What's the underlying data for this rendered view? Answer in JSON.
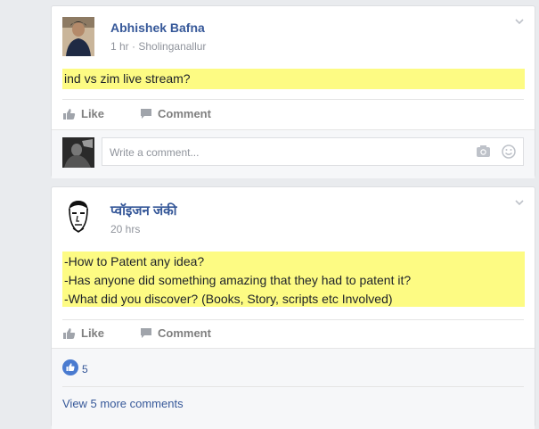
{
  "posts": [
    {
      "author": "Abhishek Bafna",
      "time": "1 hr",
      "separator": " · ",
      "location": "Sholinganallur",
      "lines": [
        "ind vs zim live stream?"
      ],
      "like_label": "Like",
      "comment_label": "Comment",
      "comment_placeholder": "Write a comment..."
    },
    {
      "author": "प्वॉइजन जंकी",
      "time": "20 hrs",
      "lines": [
        "-How to Patent any idea?",
        "-Has anyone did something amazing that they had to patent it?",
        "-What did you discover? (Books, Story, scripts etc Involved)"
      ],
      "like_label": "Like",
      "comment_label": "Comment",
      "like_count": "5",
      "view_more": "View 5 more comments"
    }
  ],
  "colors": {
    "link": "#365899",
    "highlight": "#fdfb83",
    "background": "#e9ebee"
  },
  "icons": [
    "chevron-down-icon",
    "like-thumb-icon",
    "comment-bubble-icon",
    "camera-icon",
    "emoji-icon",
    "like-reaction-icon"
  ]
}
